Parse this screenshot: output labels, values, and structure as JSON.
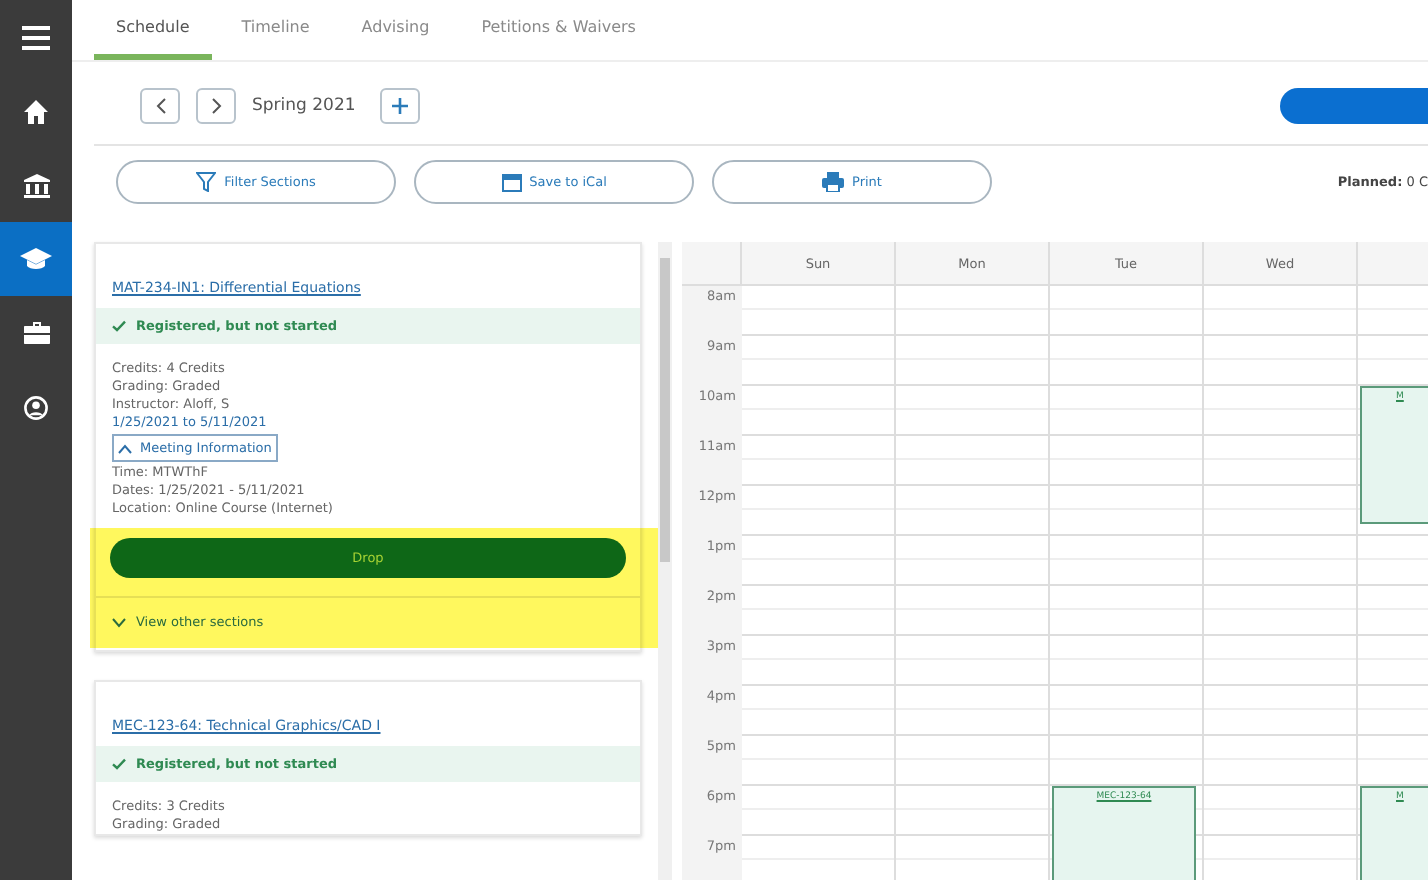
{
  "sidebar": {
    "items": [
      {
        "kind": "menu",
        "selected": false
      },
      {
        "kind": "home",
        "selected": false
      },
      {
        "kind": "bank",
        "selected": false
      },
      {
        "kind": "cap",
        "selected": true
      },
      {
        "kind": "briefcase",
        "selected": false
      },
      {
        "kind": "user",
        "selected": false
      }
    ]
  },
  "tabs": [
    {
      "label": "Schedule",
      "selected": true
    },
    {
      "label": "Timeline",
      "selected": false
    },
    {
      "label": "Advising",
      "selected": false
    },
    {
      "label": "Petitions & Waivers",
      "selected": false
    }
  ],
  "term": {
    "label": "Spring 2021"
  },
  "actions": [
    {
      "kind": "filter",
      "label": "Filter Sections"
    },
    {
      "kind": "calendar",
      "label": "Save to iCal"
    },
    {
      "kind": "print",
      "label": "Print"
    }
  ],
  "planned": "**Planned:** 0 C",
  "courses": [
    {
      "title": "MAT-234-IN1: Differential Equations",
      "status": "Registered, but not started",
      "details": [
        "Credits: 4 Credits",
        "Grading: Graded",
        "Instructor: Aloff, S"
      ],
      "dates": "1/25/2021 to 5/11/2021",
      "meeting": {
        "label": "Meeting Information",
        "expanded": true,
        "lines": [
          "Time: MTWThF",
          "Dates: 1/25/2021 - 5/11/2021",
          "Location: Online Course (Internet)"
        ]
      },
      "drop": "Drop",
      "other": "View other sections",
      "highlighted": true
    },
    {
      "title": "MEC-123-64: Technical Graphics/CAD I",
      "status": "Registered, but not started",
      "details": [
        "Credits: 3 Credits",
        "Grading: Graded"
      ],
      "highlighted": false
    }
  ],
  "calendar": {
    "days": [
      {
        "label": "Sun"
      },
      {
        "label": "Mon"
      },
      {
        "label": "Tue",
        "events": [
          {
            "kind": "evening",
            "label": "MEC-123-64"
          }
        ]
      },
      {
        "label": "Wed"
      },
      {
        "events": [
          {
            "kind": "morning",
            "label": "M"
          },
          {
            "kind": "evening",
            "label": "M"
          }
        ]
      }
    ],
    "times": [
      "8am",
      "9am",
      "10am",
      "11am",
      "12pm",
      "1pm",
      "2pm",
      "3pm",
      "4pm",
      "5pm",
      "6pm",
      "7pm"
    ]
  }
}
